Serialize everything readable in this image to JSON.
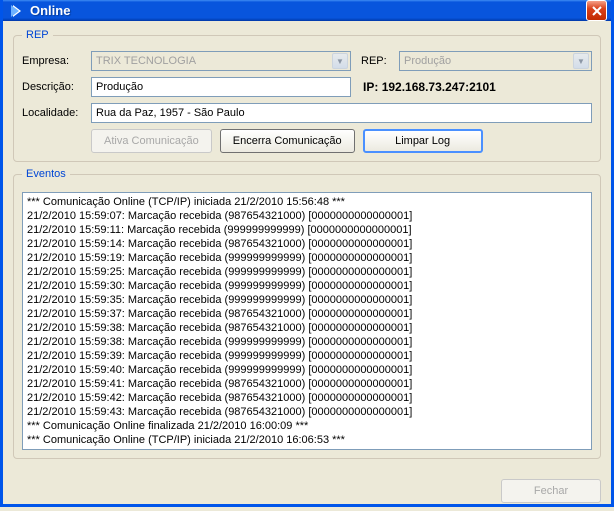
{
  "window": {
    "title": "Online"
  },
  "rep": {
    "legend": "REP",
    "labels": {
      "empresa": "Empresa:",
      "rep": "REP:",
      "descricao": "Descrição:",
      "ip_prefix": "IP:",
      "localidade": "Localidade:"
    },
    "empresa": "TRIX TECNOLOGIA",
    "rep_value": "Produção",
    "descricao": "Produção",
    "ip": "192.168.73.247:2101",
    "localidade": "Rua da Paz, 1957 - São Paulo",
    "buttons": {
      "ativa": "Ativa Comunicação",
      "encerra": "Encerra Comunicação",
      "limpar": "Limpar Log"
    }
  },
  "eventos": {
    "legend": "Eventos",
    "items": [
      "*** Comunicação Online (TCP/IP) iniciada 21/2/2010 15:56:48 ***",
      "21/2/2010 15:59:07: Marcação recebida (987654321000) [0000000000000001]",
      "21/2/2010 15:59:11: Marcação recebida (999999999999) [0000000000000001]",
      "21/2/2010 15:59:14: Marcação recebida (987654321000) [0000000000000001]",
      "21/2/2010 15:59:19: Marcação recebida (999999999999) [0000000000000001]",
      "21/2/2010 15:59:25: Marcação recebida (999999999999) [0000000000000001]",
      "21/2/2010 15:59:30: Marcação recebida (999999999999) [0000000000000001]",
      "21/2/2010 15:59:35: Marcação recebida (999999999999) [0000000000000001]",
      "21/2/2010 15:59:37: Marcação recebida (987654321000) [0000000000000001]",
      "21/2/2010 15:59:38: Marcação recebida (987654321000) [0000000000000001]",
      "21/2/2010 15:59:38: Marcação recebida (999999999999) [0000000000000001]",
      "21/2/2010 15:59:39: Marcação recebida (999999999999) [0000000000000001]",
      "21/2/2010 15:59:40: Marcação recebida (999999999999) [0000000000000001]",
      "21/2/2010 15:59:41: Marcação recebida (987654321000) [0000000000000001]",
      "21/2/2010 15:59:42: Marcação recebida (987654321000) [0000000000000001]",
      "21/2/2010 15:59:43: Marcação recebida (987654321000) [0000000000000001]",
      "*** Comunicação Online finalizada 21/2/2010 16:00:09 ***",
      "*** Comunicação Online (TCP/IP) iniciada 21/2/2010 16:06:53 ***"
    ]
  },
  "footer": {
    "fechar": "Fechar"
  }
}
